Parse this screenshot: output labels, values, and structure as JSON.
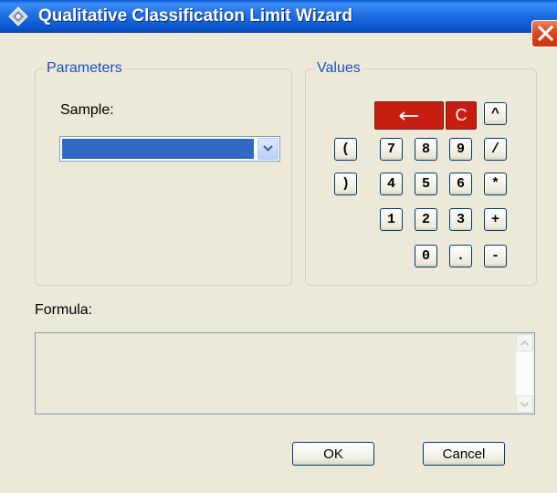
{
  "window": {
    "title": "Qualitative Classification Limit Wizard",
    "icons": {
      "app": "wizard-app-icon",
      "close": "close-icon"
    },
    "colors": {
      "accent": "#316ac5",
      "keypad_red": "#c81e12",
      "group_label": "#1d4fbf"
    }
  },
  "parameters": {
    "group_label": "Parameters",
    "sample_label": "Sample:",
    "sample_value": ""
  },
  "values": {
    "group_label": "Values",
    "keys": {
      "backspace": "←",
      "clear": "C",
      "caret": "^",
      "open_paren": "(",
      "close_paren": ")",
      "k7": "7",
      "k8": "8",
      "k9": "9",
      "divide": "/",
      "k4": "4",
      "k5": "5",
      "k6": "6",
      "multiply": "*",
      "k1": "1",
      "k2": "2",
      "k3": "3",
      "plus": "+",
      "k0": "0",
      "dot": ".",
      "minus": "-"
    }
  },
  "formula": {
    "label": "Formula:",
    "value": ""
  },
  "buttons": {
    "ok": "OK",
    "cancel": "Cancel"
  }
}
